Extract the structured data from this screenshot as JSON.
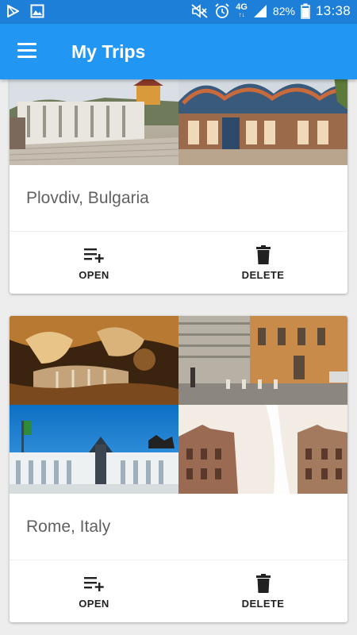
{
  "status_bar": {
    "left_icons": [
      "play-store-icon",
      "image-icon"
    ],
    "right_icons": [
      "mute-icon",
      "alarm-icon",
      "signal-icon",
      "battery-icon"
    ],
    "network": "4G",
    "battery": "82%",
    "time": "13:38"
  },
  "app_bar": {
    "title": "My Trips",
    "menu_icon": "menu-icon"
  },
  "trips": [
    {
      "name": "Plovdiv, Bulgaria",
      "open_label": "OPEN",
      "delete_label": "DELETE"
    },
    {
      "name": "Rome, Italy",
      "open_label": "OPEN",
      "delete_label": "DELETE"
    }
  ],
  "colors": {
    "status_bar": "#1e7fd8",
    "app_bar": "#2196f3",
    "background": "#ededed",
    "card": "#ffffff",
    "title_text": "#616161",
    "action_text": "#212121"
  }
}
